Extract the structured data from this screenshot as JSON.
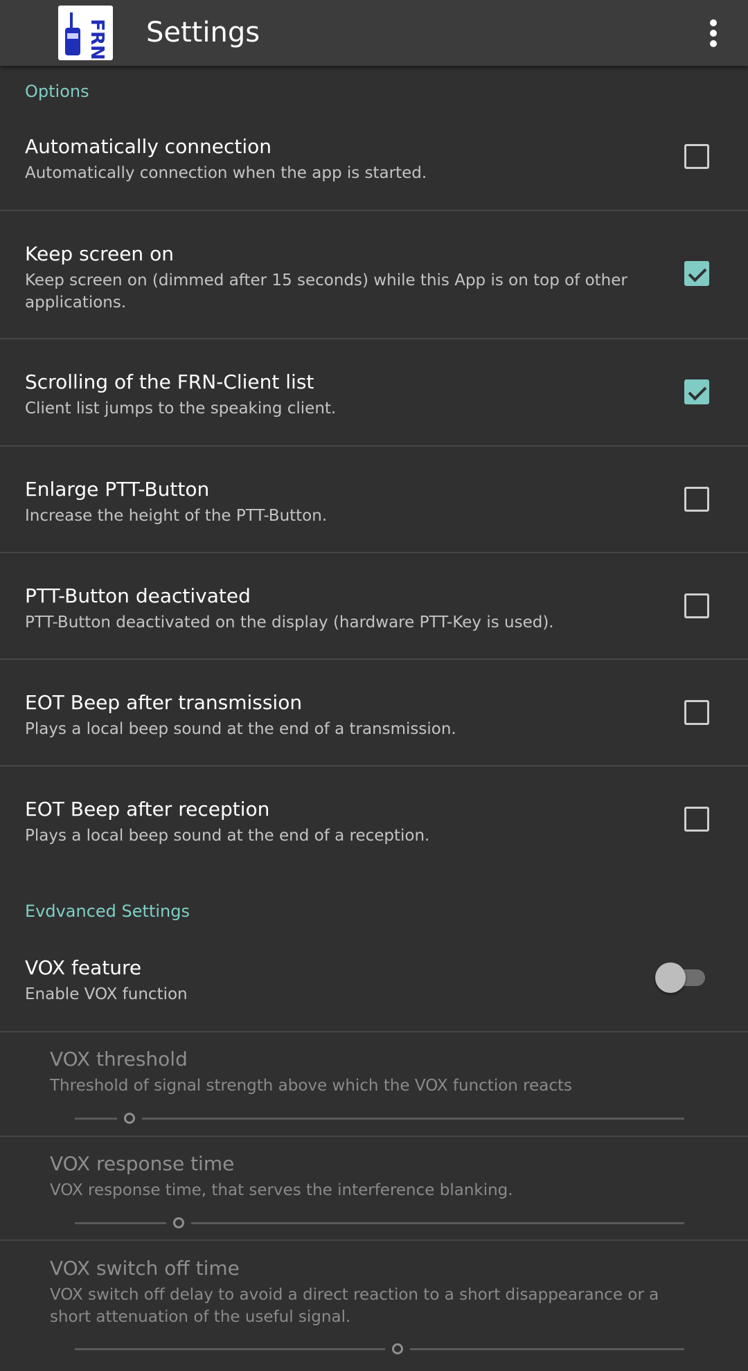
{
  "appbar": {
    "title": "Settings",
    "icon": "frn-app-icon",
    "icon_text": "FRN",
    "menu_icon": "more-vert-icon"
  },
  "sections": {
    "options": "Options",
    "advanced": "Evdvanced Settings"
  },
  "options": [
    {
      "title": "Automatically connection",
      "summary": "Automatically connection when the app is started.",
      "checked": false
    },
    {
      "title": "Keep screen on",
      "summary": "Keep screen on (dimmed after 15 seconds) while this App is on top of other applications.",
      "checked": true
    },
    {
      "title": "Scrolling of the FRN-Client list",
      "summary": "Client list jumps to the speaking client.",
      "checked": true
    },
    {
      "title": "Enlarge PTT-Button",
      "summary": "Increase the height of the PTT-Button.",
      "checked": false
    },
    {
      "title": "PTT-Button deactivated",
      "summary": "PTT-Button deactivated on the display (hardware PTT-Key is used).",
      "checked": false
    },
    {
      "title": "EOT Beep after transmission",
      "summary": "Plays a local beep sound at the end of a transmission.",
      "checked": false
    },
    {
      "title": "EOT Beep after reception",
      "summary": "Plays a local beep sound at the end of a reception.",
      "checked": false
    }
  ],
  "advanced": {
    "vox": {
      "title": "VOX feature",
      "summary": "Enable VOX function",
      "enabled": false
    },
    "sliders": [
      {
        "title": "VOX threshold",
        "summary": "Threshold of signal strength above which the VOX function reacts",
        "level": 0.09
      },
      {
        "title": "VOX response time",
        "summary": "VOX response time, that serves the interference blanking.",
        "level": 0.17
      },
      {
        "title": "VOX switch off time",
        "summary": "VOX switch off delay to avoid a direct reaction to a short disappearance or a short attenuation of the useful signal.",
        "level": 0.53
      }
    ]
  },
  "colors": {
    "accent": "#80cbc4",
    "section_header": "#7fcfc5",
    "background": "#303030",
    "appbar": "#3c3c3c"
  }
}
